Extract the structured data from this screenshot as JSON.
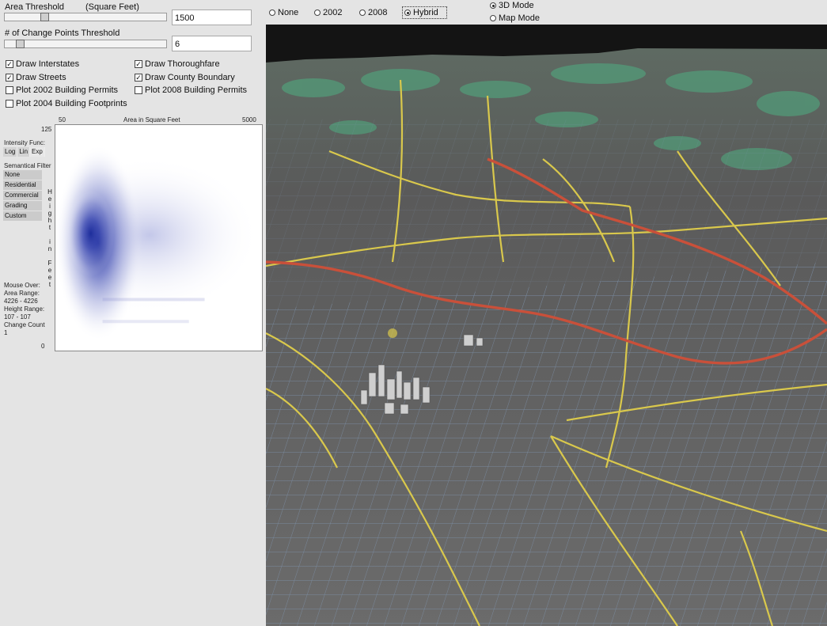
{
  "controls": {
    "area_threshold": {
      "label": "Area Threshold",
      "unit": "(Square Feet)",
      "value": "1500"
    },
    "change_points": {
      "label": "# of Change Points Threshold",
      "value": "6"
    }
  },
  "checkboxes": {
    "interstates": {
      "label": "Draw Interstates",
      "checked": true
    },
    "thoroughfare": {
      "label": "Draw Thoroughfare",
      "checked": true
    },
    "streets": {
      "label": "Draw Streets",
      "checked": true
    },
    "county": {
      "label": "Draw County Boundary",
      "checked": true
    },
    "permits2002": {
      "label": "Plot 2002 Building Permits",
      "checked": false
    },
    "permits2008": {
      "label": "Plot 2008 Building Permits",
      "checked": false
    },
    "footprints2004": {
      "label": "Plot 2004 Building Footprints",
      "checked": false
    }
  },
  "plot": {
    "x_min": "50",
    "x_label": "Area in Square Feet",
    "x_max": "5000",
    "y_max": "125",
    "y_min": "0",
    "y_label_chars": [
      "H",
      "e",
      "i",
      "g",
      "h",
      "t",
      "",
      "i",
      "n",
      "",
      "F",
      "e",
      "e",
      "t"
    ]
  },
  "intensity": {
    "label": "Intensity Func:",
    "options": [
      "Log",
      "Lin",
      "Exp"
    ]
  },
  "semantic_filter": {
    "label": "Semantical Filter",
    "options": [
      "None",
      "Residential",
      "Commercial",
      "Grading",
      "Custom"
    ]
  },
  "mouse_over": {
    "title": "Mouse Over:",
    "area_label": "Area Range:",
    "area_value": "4226  -  4226",
    "height_label": "Height Range:",
    "height_value": "107  -  107",
    "change_label": "Change Count",
    "change_value": "1"
  },
  "layer_radios": {
    "none": {
      "label": "None",
      "selected": false
    },
    "y2002": {
      "label": "2002",
      "selected": false
    },
    "y2008": {
      "label": "2008",
      "selected": false
    },
    "hybrid": {
      "label": "Hybrid",
      "selected": true
    }
  },
  "mode_radios": {
    "mode3d": {
      "label": "3D Mode",
      "selected": true
    },
    "map": {
      "label": "Map Mode",
      "selected": false
    }
  },
  "colors": {
    "interstate": "#c9503a",
    "thoroughfare": "#d9c84c",
    "street": "#7f95b3",
    "terrain": "#666666",
    "vegetation": "#4fae82",
    "density": "#1a2a9a"
  }
}
